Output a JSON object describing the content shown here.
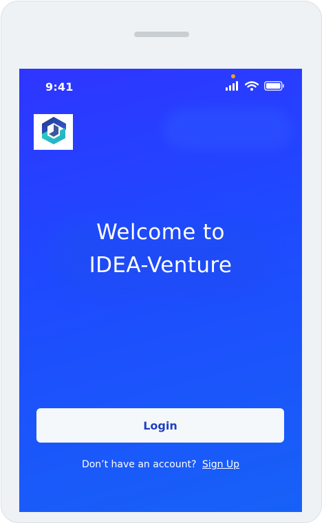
{
  "status_bar": {
    "time": "9:41"
  },
  "icons": {
    "signal": "cellular-signal-icon",
    "wifi": "wifi-icon",
    "battery": "battery-icon",
    "logo": "idea-venture-logo"
  },
  "welcome": {
    "line1": "Welcome to",
    "line2": "IDEA-Venture"
  },
  "login": {
    "label": "Login"
  },
  "signup": {
    "prompt": "Don’t have an account?",
    "link": "Sign Up"
  },
  "colors": {
    "screen_gradient_start": "#2f35ff",
    "screen_gradient_end": "#1761f7",
    "button_background": "#f4f8fb",
    "button_text": "#1f3fbf",
    "camera_indicator": "#ff9a1f"
  }
}
